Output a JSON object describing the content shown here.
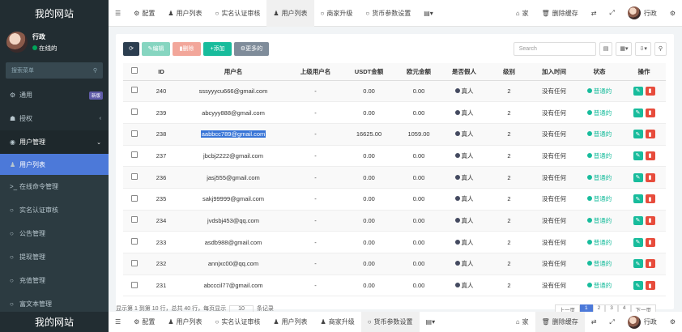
{
  "sidebar": {
    "brand": "我的网站",
    "user_name": "行政",
    "user_status": "在线的",
    "search_placeholder": "搜索菜单",
    "items": [
      {
        "label": "通用",
        "badge": "新版"
      },
      {
        "label": "授权"
      },
      {
        "label": "用户管理"
      },
      {
        "label": "用户列表"
      },
      {
        "label": "在线命令管理"
      },
      {
        "label": "实名认证审核"
      },
      {
        "label": "公告管理"
      },
      {
        "label": "提现管理"
      },
      {
        "label": "充值管理"
      },
      {
        "label": "富文本管理"
      }
    ]
  },
  "topbar": {
    "tabs": [
      {
        "label": "配置",
        "icon": "gear-icon"
      },
      {
        "label": "用户列表",
        "icon": "user-icon"
      },
      {
        "label": "实名认证审核",
        "icon": "circle-icon"
      },
      {
        "label": "用户列表",
        "icon": "user-icon"
      },
      {
        "label": "商家升级",
        "icon": "circle-icon"
      },
      {
        "label": "货币参数设置",
        "icon": "circle-icon"
      }
    ],
    "home": "家",
    "clear_cache": "删除缓存",
    "user_name": "行政"
  },
  "toolbar": {
    "edit": "编辑",
    "delete": "删除",
    "add": "添加",
    "more": "更多的",
    "search_placeholder": "Search"
  },
  "table": {
    "columns": [
      "ID",
      "用户名",
      "上级用户名",
      "USDT金额",
      "欧元金额",
      "是否假人",
      "级别",
      "加入时间",
      "状态",
      "操作"
    ],
    "rows": [
      {
        "id": "240",
        "username": "sssyyycu666@gmail.com",
        "parent": "-",
        "usdt": "0.00",
        "eur": "0.00",
        "fake": "真人",
        "level": "2",
        "joined": "没有任何",
        "status": "普通的"
      },
      {
        "id": "239",
        "username": "abcyyy888@gmail.com",
        "parent": "-",
        "usdt": "0.00",
        "eur": "0.00",
        "fake": "真人",
        "level": "2",
        "joined": "没有任何",
        "status": "普通的"
      },
      {
        "id": "238",
        "username": "aabbcc789@gmail.com",
        "parent": "-",
        "usdt": "16625.00",
        "eur": "1059.00",
        "fake": "真人",
        "level": "2",
        "joined": "没有任何",
        "status": "普通的",
        "selected": true
      },
      {
        "id": "237",
        "username": "jbcbj2222@gmail.com",
        "parent": "-",
        "usdt": "0.00",
        "eur": "0.00",
        "fake": "真人",
        "level": "2",
        "joined": "没有任何",
        "status": "普通的"
      },
      {
        "id": "236",
        "username": "jasj555@gmail.com",
        "parent": "-",
        "usdt": "0.00",
        "eur": "0.00",
        "fake": "真人",
        "level": "2",
        "joined": "没有任何",
        "status": "普通的"
      },
      {
        "id": "235",
        "username": "sakj99999@gmail.com",
        "parent": "-",
        "usdt": "0.00",
        "eur": "0.00",
        "fake": "真人",
        "level": "2",
        "joined": "没有任何",
        "status": "普通的"
      },
      {
        "id": "234",
        "username": "jvdsbj453@qq.com",
        "parent": "-",
        "usdt": "0.00",
        "eur": "0.00",
        "fake": "真人",
        "level": "2",
        "joined": "没有任何",
        "status": "普通的"
      },
      {
        "id": "233",
        "username": "asdb988@gmail.com",
        "parent": "-",
        "usdt": "0.00",
        "eur": "0.00",
        "fake": "真人",
        "level": "2",
        "joined": "没有任何",
        "status": "普通的"
      },
      {
        "id": "232",
        "username": "annjxc00@qq.com",
        "parent": "-",
        "usdt": "0.00",
        "eur": "0.00",
        "fake": "真人",
        "level": "2",
        "joined": "没有任何",
        "status": "普通的"
      },
      {
        "id": "231",
        "username": "abcccil77@gmail.com",
        "parent": "-",
        "usdt": "0.00",
        "eur": "0.00",
        "fake": "真人",
        "level": "2",
        "joined": "没有任何",
        "status": "普通的"
      }
    ]
  },
  "footer": {
    "summary": "显示第 1 到第 10 行，总共 40 行，每页显示",
    "page_size": "10",
    "page_size_suffix": "条记录",
    "pages": [
      "上一页",
      "1",
      "2",
      "3",
      "4",
      "下一页"
    ]
  },
  "duplicate_bar": {
    "brand": "我的网站",
    "tabs": [
      "配置",
      "用户列表",
      "实名认证审核",
      "用户列表",
      "商家升级",
      "货币参数设置"
    ],
    "home": "家",
    "clear_cache": "删除缓存",
    "user_name": "行政"
  },
  "colors": {
    "sidebar_bg": "#222d32",
    "active_item": "#4c79d9",
    "success": "#18bc9c",
    "danger": "#e74c3c"
  }
}
